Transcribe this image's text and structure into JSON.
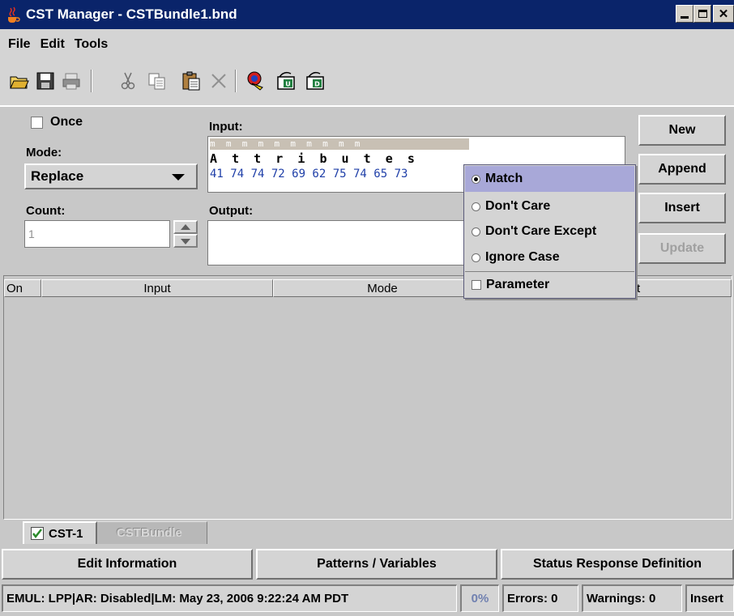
{
  "window": {
    "title": "CST Manager - CSTBundle1.bnd"
  },
  "menu": {
    "file": "File",
    "edit": "Edit",
    "tools": "Tools"
  },
  "toolbar": {
    "icons": [
      "open-folder-icon",
      "save-icon",
      "print-icon",
      "cut-icon",
      "copy-icon",
      "paste-icon",
      "delete-icon",
      "tool-a-icon",
      "tool-b-icon",
      "tool-c-icon"
    ]
  },
  "edit": {
    "once_label": "Once",
    "mode_label": "Mode:",
    "mode_value": "Replace",
    "count_label": "Count:",
    "count_value": "1",
    "input_label": "Input:",
    "output_label": "Output:",
    "input_markers": "m  m  m  m  m  m  m  m  m  m",
    "input_chars": "A  t  t  r  i  b  u  t  e  s",
    "input_hex": "41 74 74 72 69 62 75 74 65 73"
  },
  "buttons": {
    "new": "New",
    "append": "Append",
    "insert": "Insert",
    "update": "Update"
  },
  "table": {
    "columns": [
      "On",
      "Input",
      "Mode",
      "t"
    ]
  },
  "popup": {
    "items": [
      "Match",
      "Don't Care",
      "Don't Care Except",
      "Ignore Case"
    ],
    "parameter": "Parameter",
    "selected": "Match"
  },
  "tabs": {
    "tab1": "CST-1",
    "tab2": "CSTBundle"
  },
  "sections": {
    "edit_info": "Edit Information",
    "patterns": "Patterns / Variables",
    "status_resp": "Status Response Definition"
  },
  "status": {
    "info": "EMUL: LPP|AR: Disabled|LM: May 23, 2006 9:22:24 AM PDT",
    "percent": "0%",
    "errors": "Errors: 0",
    "warnings": "Warnings: 0",
    "mode": "Insert"
  },
  "colors": {
    "titlebar": "#0a246a",
    "hex_text": "#1f3fa8",
    "popup_selected": "#a8a8d8",
    "check_green": "#2a8a2a"
  }
}
